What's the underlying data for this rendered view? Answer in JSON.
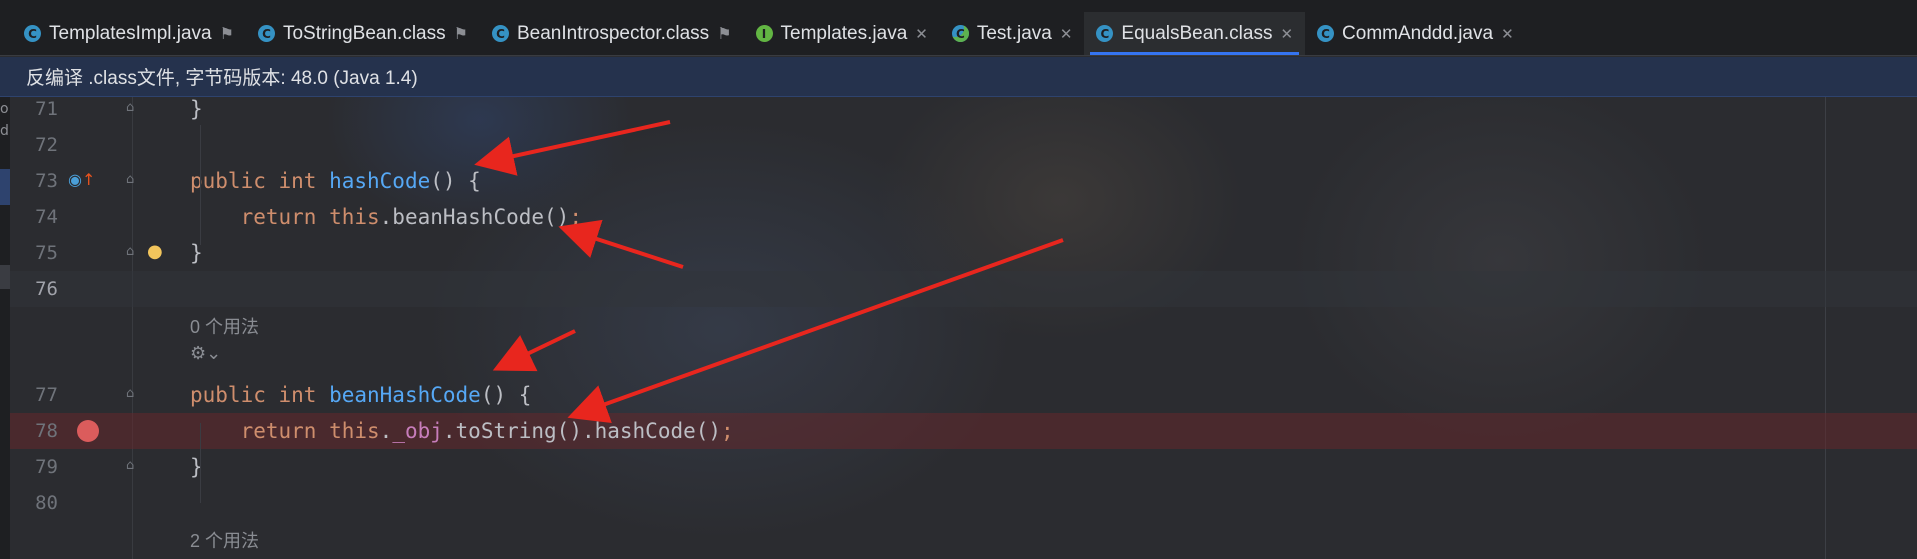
{
  "tabs": [
    {
      "label": "TemplatesImpl.java",
      "icon": "class-icon",
      "action": "pin"
    },
    {
      "label": "ToStringBean.class",
      "icon": "class-icon",
      "action": "pin"
    },
    {
      "label": "BeanIntrospector.class",
      "icon": "class-icon",
      "action": "pin"
    },
    {
      "label": "Templates.java",
      "icon": "interface-icon",
      "action": "close"
    },
    {
      "label": "Test.java",
      "icon": "test-class-icon",
      "action": "close"
    },
    {
      "label": "EqualsBean.class",
      "icon": "class-icon",
      "action": "close",
      "active": true
    },
    {
      "label": "CommAnddd.java",
      "icon": "class-icon",
      "action": "close"
    }
  ],
  "banner": {
    "text": "反编译 .class文件, 字节码版本: 48.0 (Java 1.4)"
  },
  "editor": {
    "lines": [
      {
        "num": "71",
        "code": [
          {
            "t": "}",
            "c": "plain"
          }
        ]
      },
      {
        "num": "72",
        "code": []
      },
      {
        "num": "73",
        "code": [
          {
            "t": "public ",
            "c": "kw"
          },
          {
            "t": "int ",
            "c": "kw"
          },
          {
            "t": "hashCode",
            "c": "fn"
          },
          {
            "t": "() {",
            "c": "plain"
          }
        ]
      },
      {
        "num": "74",
        "code": [
          {
            "t": "    return ",
            "c": "kw"
          },
          {
            "t": "this",
            "c": "kw"
          },
          {
            "t": ".beanHashCode()",
            "c": "plain"
          },
          {
            "t": ";",
            "c": "kw"
          }
        ]
      },
      {
        "num": "75",
        "code": [
          {
            "t": "}",
            "c": "plain"
          }
        ]
      },
      {
        "num": "76",
        "code": []
      },
      {
        "usage": "0 个用法"
      },
      {
        "usage_icon": "⚙⌄"
      },
      {
        "num": "77",
        "code": [
          {
            "t": "public ",
            "c": "kw"
          },
          {
            "t": "int ",
            "c": "kw"
          },
          {
            "t": "beanHashCode",
            "c": "fn"
          },
          {
            "t": "() {",
            "c": "plain"
          }
        ]
      },
      {
        "num": "78",
        "code": [
          {
            "t": "    return ",
            "c": "kw"
          },
          {
            "t": "this",
            "c": "kw"
          },
          {
            "t": ".",
            "c": "plain"
          },
          {
            "t": "_obj",
            "c": "field"
          },
          {
            "t": ".toString().hashCode()",
            "c": "plain"
          },
          {
            "t": ";",
            "c": "kw"
          }
        ]
      },
      {
        "num": "79",
        "code": [
          {
            "t": "}",
            "c": "plain"
          }
        ]
      },
      {
        "num": "80",
        "code": []
      },
      {
        "usage": "2 个用法"
      }
    ]
  },
  "colors": {
    "keyword": "#cf8e6d",
    "method": "#56a8f5",
    "field": "#c77dbb",
    "annotation_arrow": "#e8261e",
    "breakpoint": "#db5c5c"
  }
}
